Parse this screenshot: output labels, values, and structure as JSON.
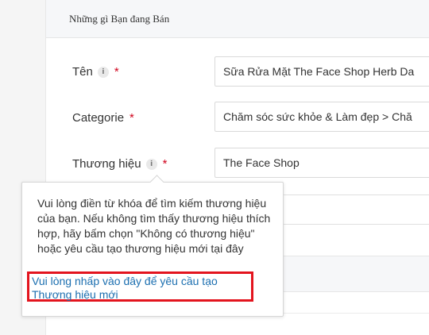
{
  "section": {
    "title": "Những gì Bạn đang Bán"
  },
  "fields": {
    "name": {
      "label": "Tên",
      "value": "Sữa Rửa Mặt The Face Shop Herb Da"
    },
    "category": {
      "label": "Categorie",
      "value": "Chăm sóc sức khỏe & Làm đẹp > Chă"
    },
    "brand": {
      "label": "Thương hiệu",
      "value": "The Face Shop"
    },
    "required_mark": "*",
    "info_glyph": "i"
  },
  "tooltip": {
    "text": "Vui lòng điền từ khóa để tìm kiếm thương hiệu của bạn. Nếu không tìm thấy thương hiệu thích hợp, hãy bấm chọn \"Không có thương hiệu\" hoặc yêu cầu tạo thương hiệu mới tại đây",
    "link": "Vui lòng nhấp vào đây để yêu cầu tạo Thương hiệu mới"
  },
  "colors": {
    "required": "#d0021b",
    "link": "#1c6fb0",
    "highlight_box": "#e3141e"
  },
  "icons": {
    "info": "info-icon"
  }
}
